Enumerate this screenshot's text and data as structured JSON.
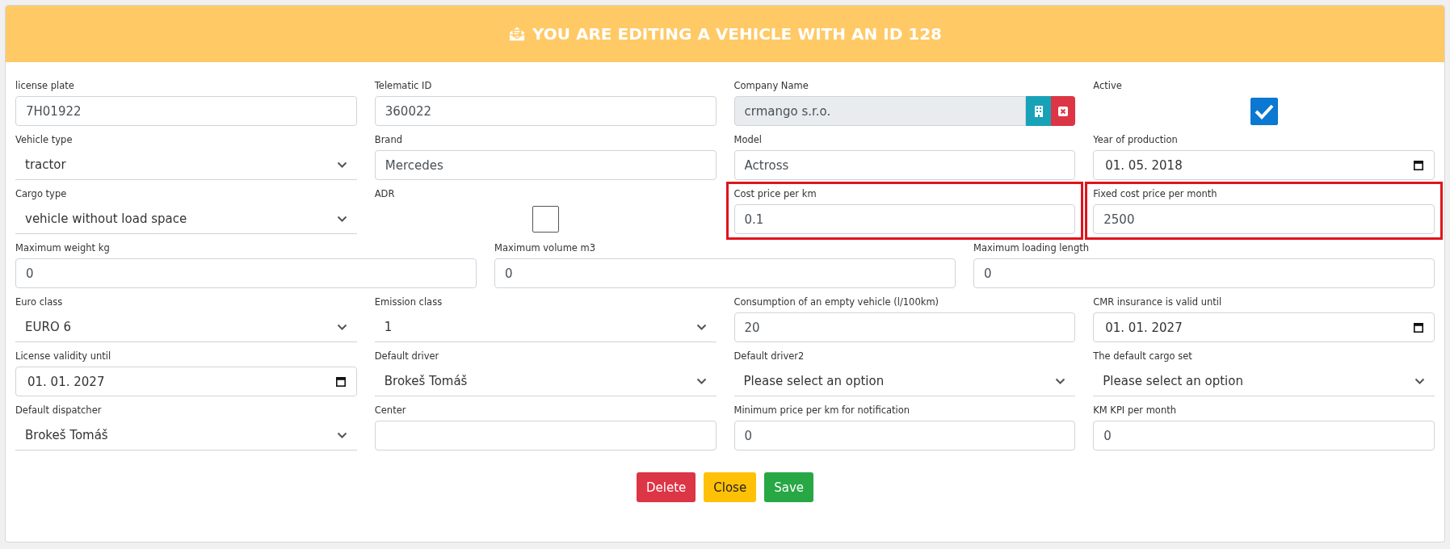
{
  "header": {
    "title": "YOU ARE EDITING A VEHICLE WITH AN ID 128"
  },
  "rows": [
    {
      "fields": [
        {
          "kind": "text",
          "label": "license plate",
          "value": "7H01922",
          "highlighted": false
        },
        {
          "kind": "text",
          "label": "Telematic ID",
          "value": "360022",
          "highlighted": false
        },
        {
          "kind": "company",
          "label": "Company Name",
          "value": "crmango s.r.o.",
          "highlighted": false
        },
        {
          "kind": "checkbox",
          "label": "Active",
          "checked": true,
          "highlighted": false
        }
      ]
    },
    {
      "fields": [
        {
          "kind": "select",
          "label": "Vehicle type",
          "value": "tractor",
          "highlighted": false
        },
        {
          "kind": "text",
          "label": "Brand",
          "value": "Mercedes",
          "highlighted": false
        },
        {
          "kind": "text",
          "label": "Model",
          "value": "Actross",
          "highlighted": false
        },
        {
          "kind": "date",
          "label": "Year of production",
          "value": "01. 05. 2018",
          "highlighted": false
        }
      ]
    },
    {
      "fields": [
        {
          "kind": "select",
          "label": "Cargo type",
          "value": "vehicle without load space",
          "highlighted": false
        },
        {
          "kind": "checkbox",
          "label": "ADR",
          "checked": false,
          "highlighted": false
        },
        {
          "kind": "text",
          "label": "Cost price per km",
          "value": "0.1",
          "highlighted": true
        },
        {
          "kind": "text",
          "label": "Fixed cost price per month",
          "value": "2500",
          "highlighted": true
        }
      ]
    },
    {
      "fields": [
        {
          "kind": "text",
          "label": "Maximum weight kg",
          "value": "0",
          "highlighted": false
        },
        {
          "kind": "text",
          "label": "Maximum volume m3",
          "value": "0",
          "highlighted": false
        },
        {
          "kind": "text",
          "label": "Maximum loading length",
          "value": "0",
          "highlighted": false
        }
      ]
    },
    {
      "fields": [
        {
          "kind": "select",
          "label": "Euro class",
          "value": "EURO 6",
          "highlighted": false
        },
        {
          "kind": "select",
          "label": "Emission class",
          "value": "1",
          "highlighted": false
        },
        {
          "kind": "text",
          "label": "Consumption of an empty vehicle (l/100km)",
          "value": "20",
          "highlighted": false
        },
        {
          "kind": "date",
          "label": "CMR insurance is valid until",
          "value": "01. 01. 2027",
          "highlighted": false
        }
      ]
    },
    {
      "fields": [
        {
          "kind": "date",
          "label": "License validity until",
          "value": "01. 01. 2027",
          "highlighted": false
        },
        {
          "kind": "select",
          "label": "Default driver",
          "value": "Brokeš Tomáš",
          "highlighted": false
        },
        {
          "kind": "select",
          "label": "Default driver2",
          "value": "Please select an option",
          "highlighted": false
        },
        {
          "kind": "select",
          "label": "The default cargo set",
          "value": "Please select an option",
          "highlighted": false
        }
      ]
    },
    {
      "fields": [
        {
          "kind": "select",
          "label": "Default dispatcher",
          "value": "Brokeš Tomáš",
          "highlighted": false
        },
        {
          "kind": "text",
          "label": "Center",
          "highlighted": false
        },
        {
          "kind": "text",
          "label": "Minimum price per km for notification",
          "value": "0",
          "highlighted": false
        },
        {
          "kind": "text",
          "label": "KM KPI per month",
          "value": "0",
          "highlighted": false
        }
      ]
    }
  ],
  "buttons": [
    {
      "label": "Delete",
      "kind": "danger"
    },
    {
      "label": "Close",
      "kind": "warning"
    },
    {
      "label": "Save",
      "kind": "success"
    }
  ]
}
